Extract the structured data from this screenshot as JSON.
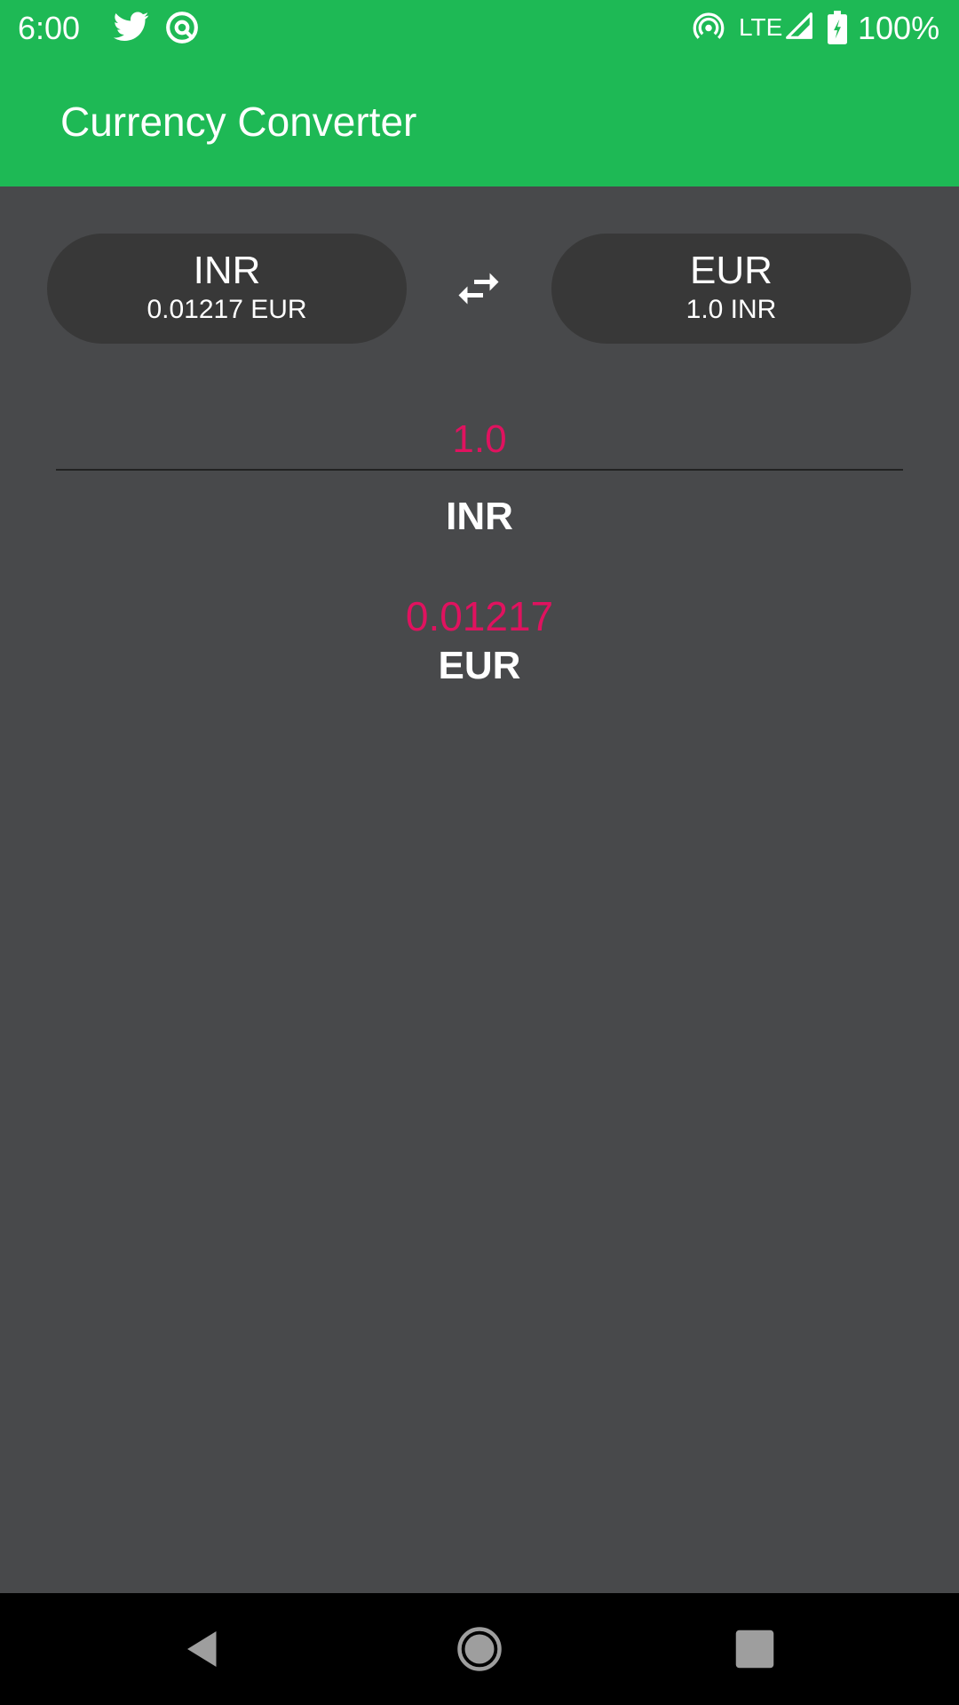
{
  "status_bar": {
    "time": "6:00",
    "network": "LTE",
    "battery": "100%",
    "icons": [
      "twitter-icon",
      "sync-icon",
      "hotspot-icon",
      "signal-icon",
      "battery-icon"
    ]
  },
  "app_bar": {
    "title": "Currency Converter",
    "color": "#1eb955"
  },
  "from_currency": {
    "code": "INR",
    "rate": "0.01217 EUR"
  },
  "to_currency": {
    "code": "EUR",
    "rate": "1.0 INR"
  },
  "swap": {
    "icon": "swap-horizontal-icon"
  },
  "converter": {
    "amount": "1.0",
    "input_code": "INR",
    "result_value": "0.01217",
    "result_code": "EUR",
    "accent": "#e0125f"
  },
  "nav_bar": {
    "icons": [
      "back-icon",
      "home-icon",
      "recents-icon"
    ]
  }
}
